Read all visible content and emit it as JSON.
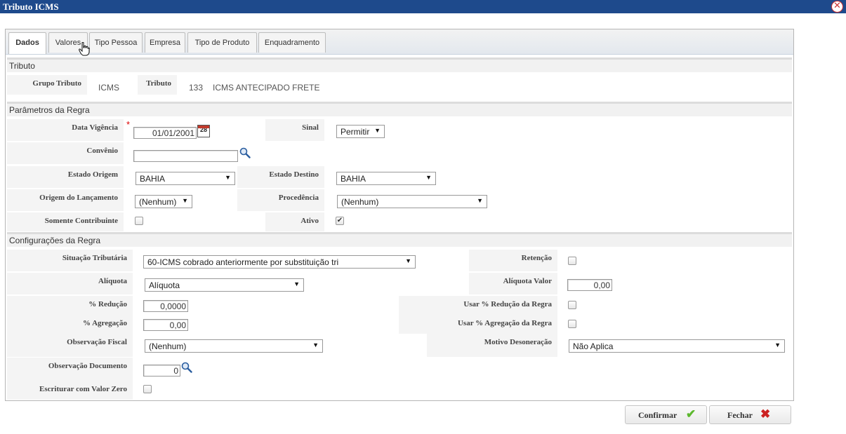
{
  "window": {
    "title": "Tributo ICMS"
  },
  "tabs": [
    {
      "label": "Dados"
    },
    {
      "label": "Valores"
    },
    {
      "label": "Tipo Pessoa"
    },
    {
      "label": "Empresa"
    },
    {
      "label": "Tipo de Produto"
    },
    {
      "label": "Enquadramento"
    }
  ],
  "tributo": {
    "header": "Tributo",
    "grupo_label": "Grupo Tributo",
    "grupo_value": "ICMS",
    "tributo_label": "Tributo",
    "tributo_code": "133",
    "tributo_desc": "ICMS ANTECIPADO FRETE"
  },
  "parametros": {
    "header": "Parâmetros da Regra",
    "data_vigencia_label": "Data Vigência",
    "data_vigencia_value": "01/01/2001",
    "calendar_day": "28",
    "sinal_label": "Sinal",
    "sinal_value": "Permitir",
    "convenio_label": "Convênio",
    "convenio_value": "",
    "estado_origem_label": "Estado Origem",
    "estado_origem_value": "BAHIA",
    "estado_destino_label": "Estado Destino",
    "estado_destino_value": "BAHIA",
    "origem_lancamento_label": "Origem do Lançamento",
    "origem_lancamento_value": "(Nenhum)",
    "procedencia_label": "Procedência",
    "procedencia_value": "(Nenhum)",
    "somente_contribuinte_label": "Somente Contribuinte",
    "somente_contribuinte_checked": false,
    "ativo_label": "Ativo",
    "ativo_checked": true
  },
  "configuracoes": {
    "header": "Configurações da Regra",
    "situacao_label": "Situação Tributária",
    "situacao_value": "60-ICMS cobrado anteriormente por substituição tri",
    "retencao_label": "Retenção",
    "retencao_checked": false,
    "aliquota_label": "Alíquota",
    "aliquota_value": "Alíquota",
    "aliquota_valor_label": "Alíquota Valor",
    "aliquota_valor_value": "0,00",
    "reducao_label": "% Redução",
    "reducao_value": "0,0000",
    "usar_reducao_label": "Usar % Redução da Regra",
    "usar_reducao_checked": false,
    "agregacao_label": "% Agregação",
    "agregacao_value": "0,00",
    "usar_agregacao_label": "Usar % Agregação da Regra",
    "usar_agregacao_checked": false,
    "obs_fiscal_label": "Observação Fiscal",
    "obs_fiscal_value": "(Nenhum)",
    "motivo_label": "Motivo Desoneração",
    "motivo_value": "Não Aplica",
    "obs_documento_label": "Observação Documento",
    "obs_documento_value": "0",
    "escriturar_label": "Escriturar com Valor Zero",
    "escriturar_checked": false
  },
  "footer": {
    "confirm_label": "Confirmar",
    "close_label": "Fechar"
  },
  "colors": {
    "titlebar": "#1e4a8c",
    "required": "#dd0000",
    "confirm_icon": "#5cb82e",
    "close_icon": "#cc2222"
  },
  "icons": {
    "close": "close-icon",
    "calendar": "calendar-icon",
    "search": "search-icon",
    "confirm": "checkmark-icon",
    "cancel": "x-icon",
    "cursor": "hand-cursor-icon"
  }
}
